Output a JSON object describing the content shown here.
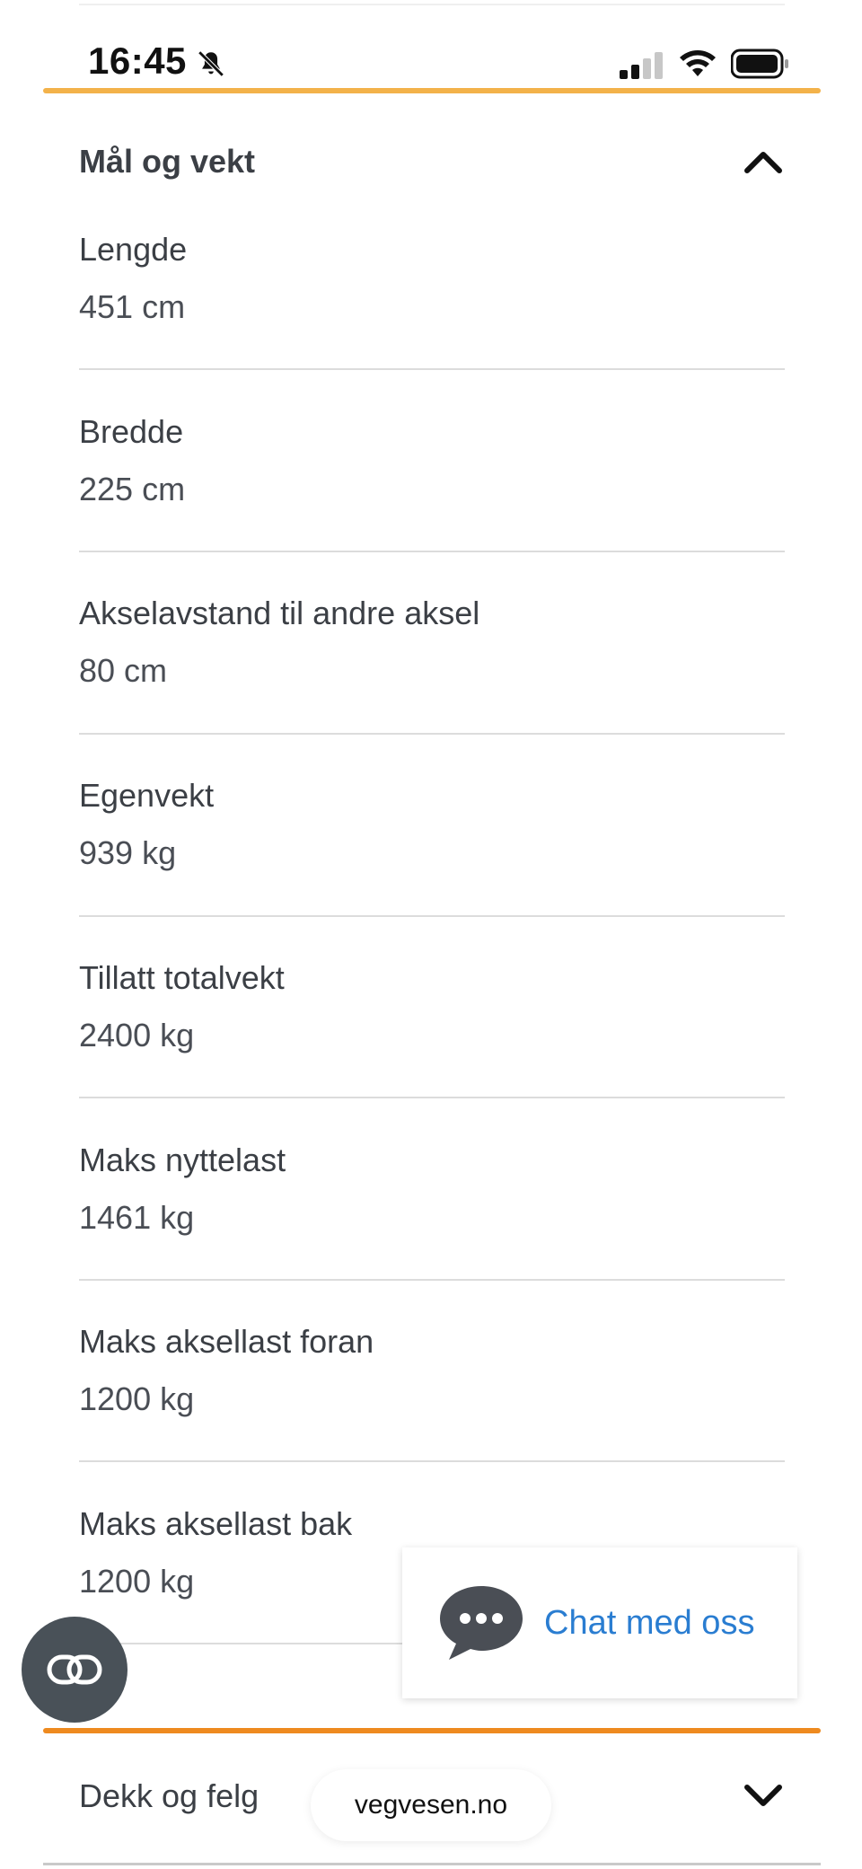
{
  "status_bar": {
    "time": "16:45"
  },
  "section_open": {
    "title": "Mål og vekt"
  },
  "specs": [
    {
      "label": "Lengde",
      "value": "451 cm"
    },
    {
      "label": "Bredde",
      "value": "225 cm"
    },
    {
      "label": "Akselavstand til andre aksel",
      "value": "80 cm"
    },
    {
      "label": "Egenvekt",
      "value": "939 kg"
    },
    {
      "label": "Tillatt totalvekt",
      "value": "2400 kg"
    },
    {
      "label": "Maks nyttelast",
      "value": "1461 kg"
    },
    {
      "label": "Maks aksellast foran",
      "value": "1200 kg"
    },
    {
      "label": "Maks aksellast bak",
      "value": "1200 kg"
    }
  ],
  "chat": {
    "label": "Chat med oss"
  },
  "section_closed": {
    "title": "Dekk og felg"
  },
  "browser": {
    "url": "vegvesen.no"
  },
  "colors": {
    "accent_light": "#f3b24a",
    "accent_dark": "#ee8a1f",
    "link": "#2a7dd1",
    "text": "#3b3f45"
  }
}
